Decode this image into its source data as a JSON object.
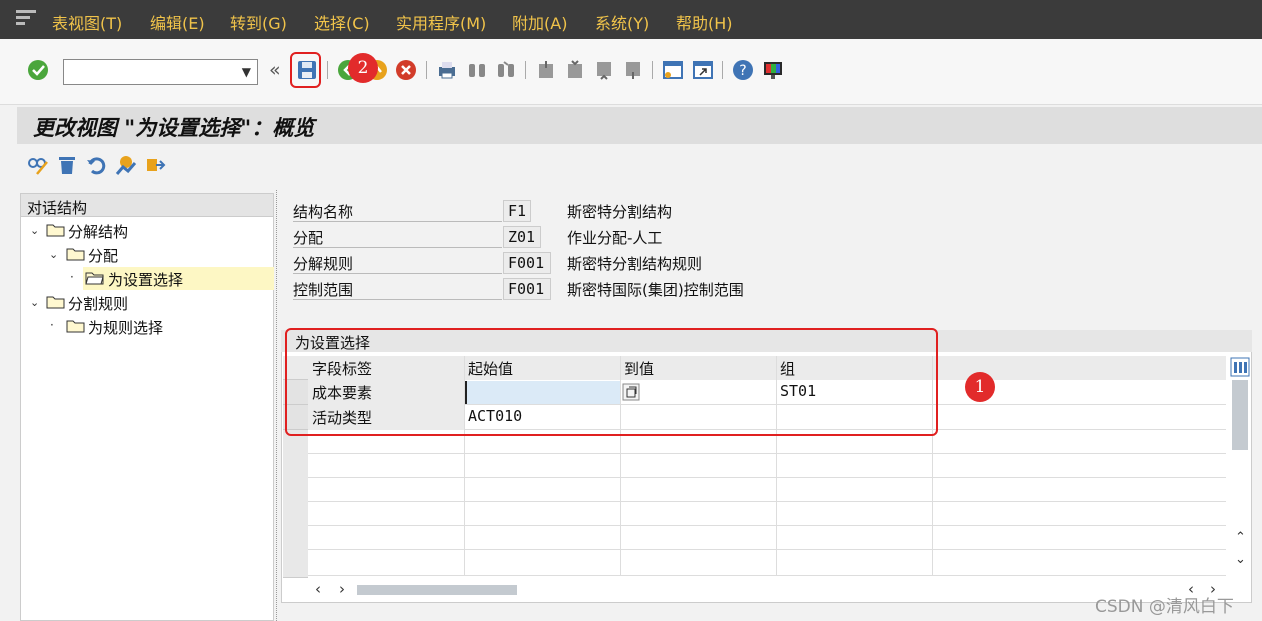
{
  "menu": [
    "表视图(T)",
    "编辑(E)",
    "转到(G)",
    "选择(C)",
    "实用程序(M)",
    "附加(A)",
    "系统(Y)",
    "帮助(H)"
  ],
  "command_field": {
    "value": ""
  },
  "page_title": "更改视图 \"为设置选择\"：概览",
  "tree": {
    "header": "对话结构",
    "nodes": [
      "分解结构",
      "分配",
      "为设置选择",
      "分割规则",
      "为规则选择"
    ]
  },
  "header_fields": [
    {
      "label": "结构名称",
      "value": "F1",
      "text": "斯密特分割结构"
    },
    {
      "label": "分配",
      "value": "Z01",
      "text": "作业分配-人工"
    },
    {
      "label": "分解规则",
      "value": "F001",
      "text": "斯密特分割结构规则"
    },
    {
      "label": "控制范围",
      "value": "F001",
      "text": "斯密特国际(集团)控制范围"
    }
  ],
  "table": {
    "title": "为设置选择",
    "columns": [
      "字段标签",
      "起始值",
      "到值",
      "组"
    ],
    "rows": [
      [
        "成本要素",
        "",
        "",
        "ST01"
      ],
      [
        "活动类型",
        "ACT010",
        "",
        ""
      ]
    ]
  },
  "annotations": {
    "badge1": "1",
    "badge2": "2"
  },
  "watermark": "CSDN @清风白下",
  "colors": {
    "menubar": "#3b3b3b",
    "menu_text": "#f0c34a",
    "annotation": "#e02020",
    "selected_node": "#fdf7c4"
  }
}
